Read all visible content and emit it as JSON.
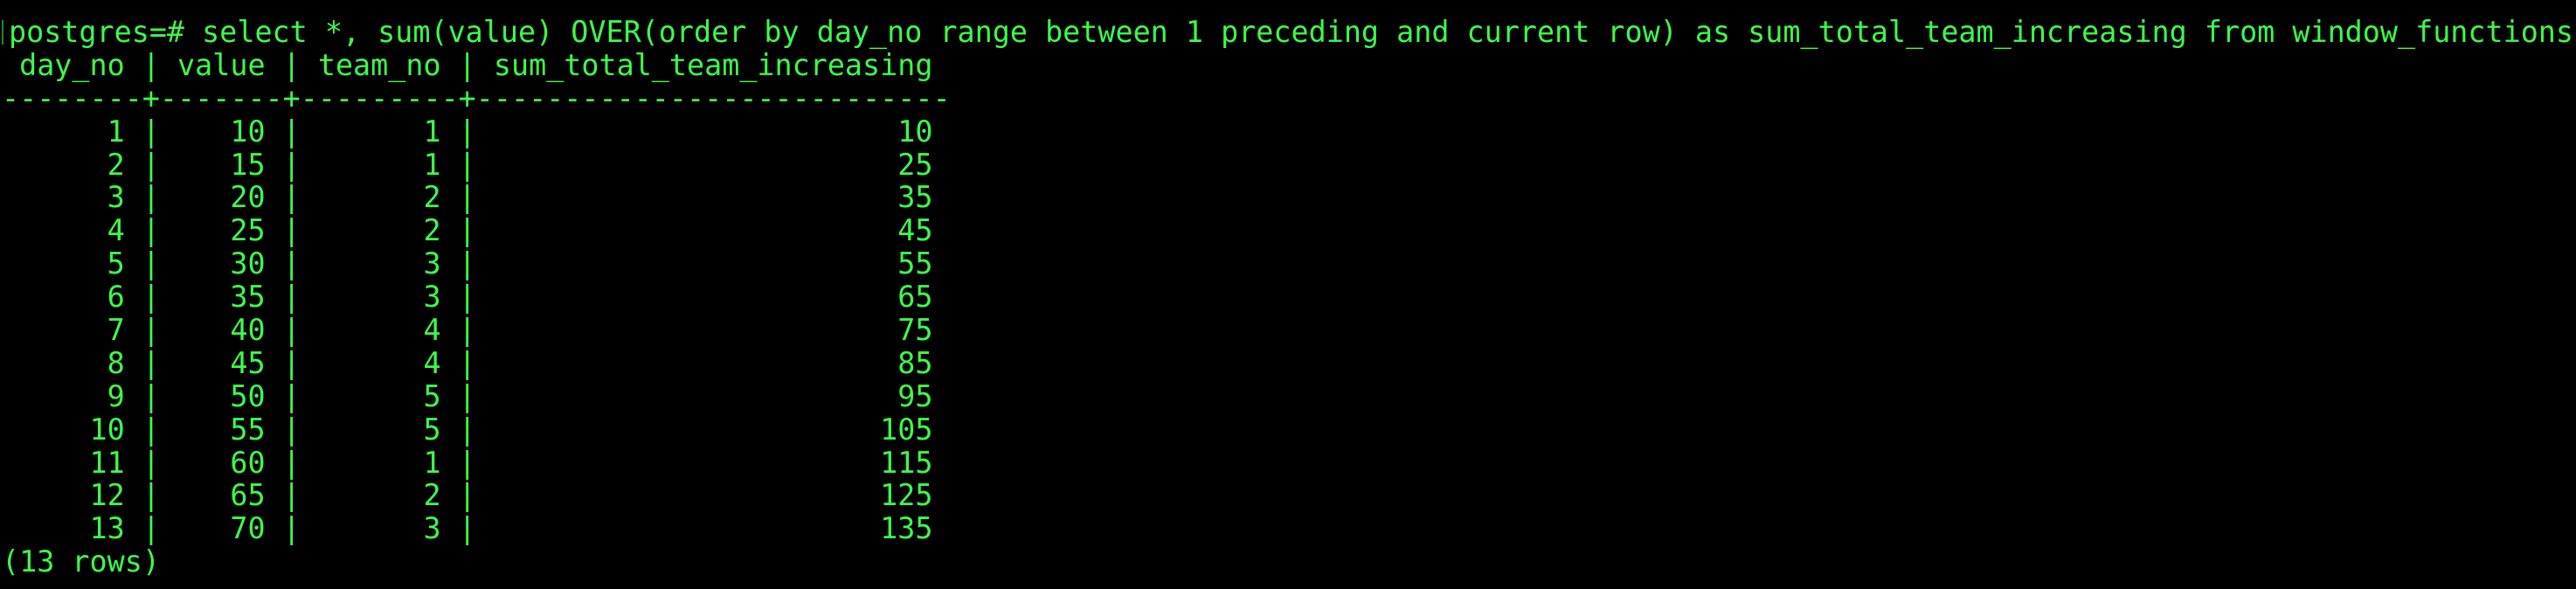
{
  "terminal": {
    "command_line": "postgres=# select *, sum(value) OVER(order by day_no range between 1 preceding and current row) as sum_total_team_increasing from window_functions;",
    "header": " day_no | value | team_no | sum_total_team_increasing ",
    "separator": "--------+-------+---------+---------------------------",
    "rows": [
      "      1 |    10 |       1 |                        10",
      "      2 |    15 |       1 |                        25",
      "      3 |    20 |       2 |                        35",
      "      4 |    25 |       2 |                        45",
      "      5 |    30 |       3 |                        55",
      "      6 |    35 |       3 |                        65",
      "      7 |    40 |       4 |                        75",
      "      8 |    45 |       4 |                        85",
      "      9 |    50 |       5 |                        95",
      "     10 |    55 |       5 |                       105",
      "     11 |    60 |       1 |                       115",
      "     12 |    65 |       2 |                       125",
      "     13 |    70 |       3 |                       135"
    ],
    "footer": "(13 rows)",
    "text_color": "#3dfb4a",
    "background_color": "#000000"
  }
}
